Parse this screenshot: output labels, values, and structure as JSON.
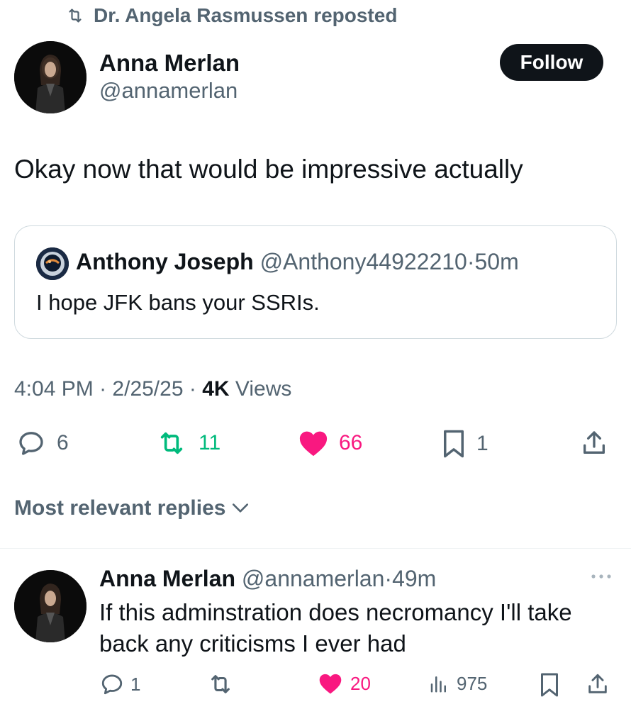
{
  "repost_header": {
    "text": "Dr. Angela Rasmussen reposted"
  },
  "tweet": {
    "author_name": "Anna Merlan",
    "author_handle": "@annamerlan",
    "follow_label": "Follow",
    "text": "Okay now that would be impressive actually",
    "quote": {
      "author_name": "Anthony Joseph",
      "author_handle": "@Anthony44922210",
      "age": "50m",
      "text": "I hope JFK bans your SSRIs."
    },
    "time": "4:04 PM",
    "date": "2/25/25",
    "views_count": "4K",
    "views_label": "Views",
    "stats": {
      "replies": "6",
      "reposts": "11",
      "likes": "66",
      "bookmarks": "1"
    }
  },
  "replies_sort": {
    "label": "Most relevant replies"
  },
  "reply": {
    "author_name": "Anna Merlan",
    "author_handle": "@annamerlan",
    "age": "49m",
    "text": "If this adminstration does necromancy I'll take back any criticisms I ever had",
    "stats": {
      "replies": "1",
      "likes": "20",
      "views": "975"
    }
  },
  "colors": {
    "text_primary": "#0f1419",
    "text_secondary": "#536471",
    "repost_green": "#00ba7c",
    "like_pink": "#f91880",
    "border": "#cfd9de"
  },
  "icons": [
    "repost-icon",
    "reply-icon",
    "heart-icon",
    "bookmark-icon",
    "share-icon",
    "chevron-down-icon",
    "more-icon",
    "views-icon"
  ]
}
